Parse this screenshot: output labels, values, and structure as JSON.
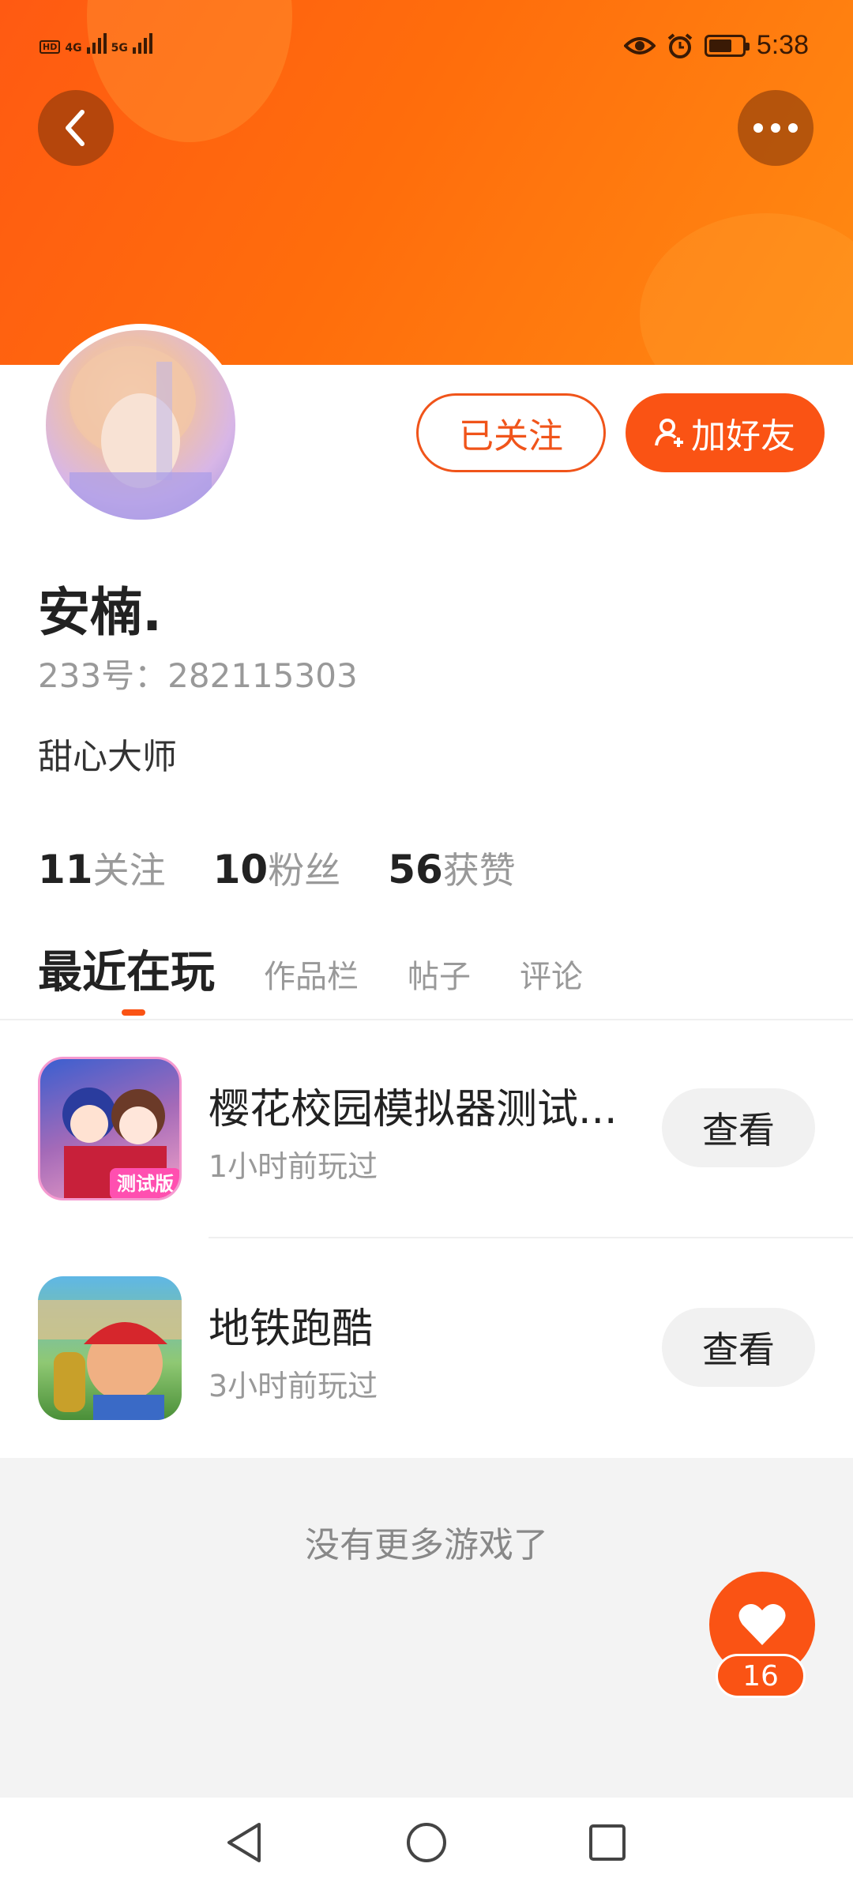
{
  "status_bar": {
    "network_1": "4G",
    "network_2": "5G",
    "time": "5:38",
    "icons": [
      "hd-icon",
      "signal-icon",
      "eye-icon",
      "alarm-icon",
      "battery-icon"
    ],
    "battery_level": 0.7
  },
  "header": {
    "back_icon": "chevron-left-icon",
    "more_icon": "more-dots-icon",
    "banner_color": "#ff6a0f"
  },
  "profile": {
    "name": "安楠.",
    "uid": "233号：282115303",
    "bio": "甜心大师",
    "follow_button": "已关注",
    "add_friend_button": "加好友"
  },
  "stats": [
    {
      "num": "11",
      "label": "关注"
    },
    {
      "num": "10",
      "label": "粉丝"
    },
    {
      "num": "56",
      "label": "获赞"
    }
  ],
  "tabs": [
    {
      "label": "最近在玩",
      "active": true
    },
    {
      "label": "作品栏",
      "active": false
    },
    {
      "label": "帖子",
      "active": false
    },
    {
      "label": "评论",
      "active": false
    }
  ],
  "games": [
    {
      "title": "樱花校园模拟器测试...",
      "subtitle": "1小时前玩过",
      "button": "查看",
      "icon_badge": "测试版"
    },
    {
      "title": "地铁跑酷",
      "subtitle": "3小时前玩过",
      "button": "查看",
      "icon_badge": ""
    }
  ],
  "footer_text": "没有更多游戏了",
  "like": {
    "count": "16",
    "icon": "heart-icon"
  },
  "colors": {
    "accent": "#fa5314",
    "muted": "#999999",
    "text": "#222222"
  }
}
